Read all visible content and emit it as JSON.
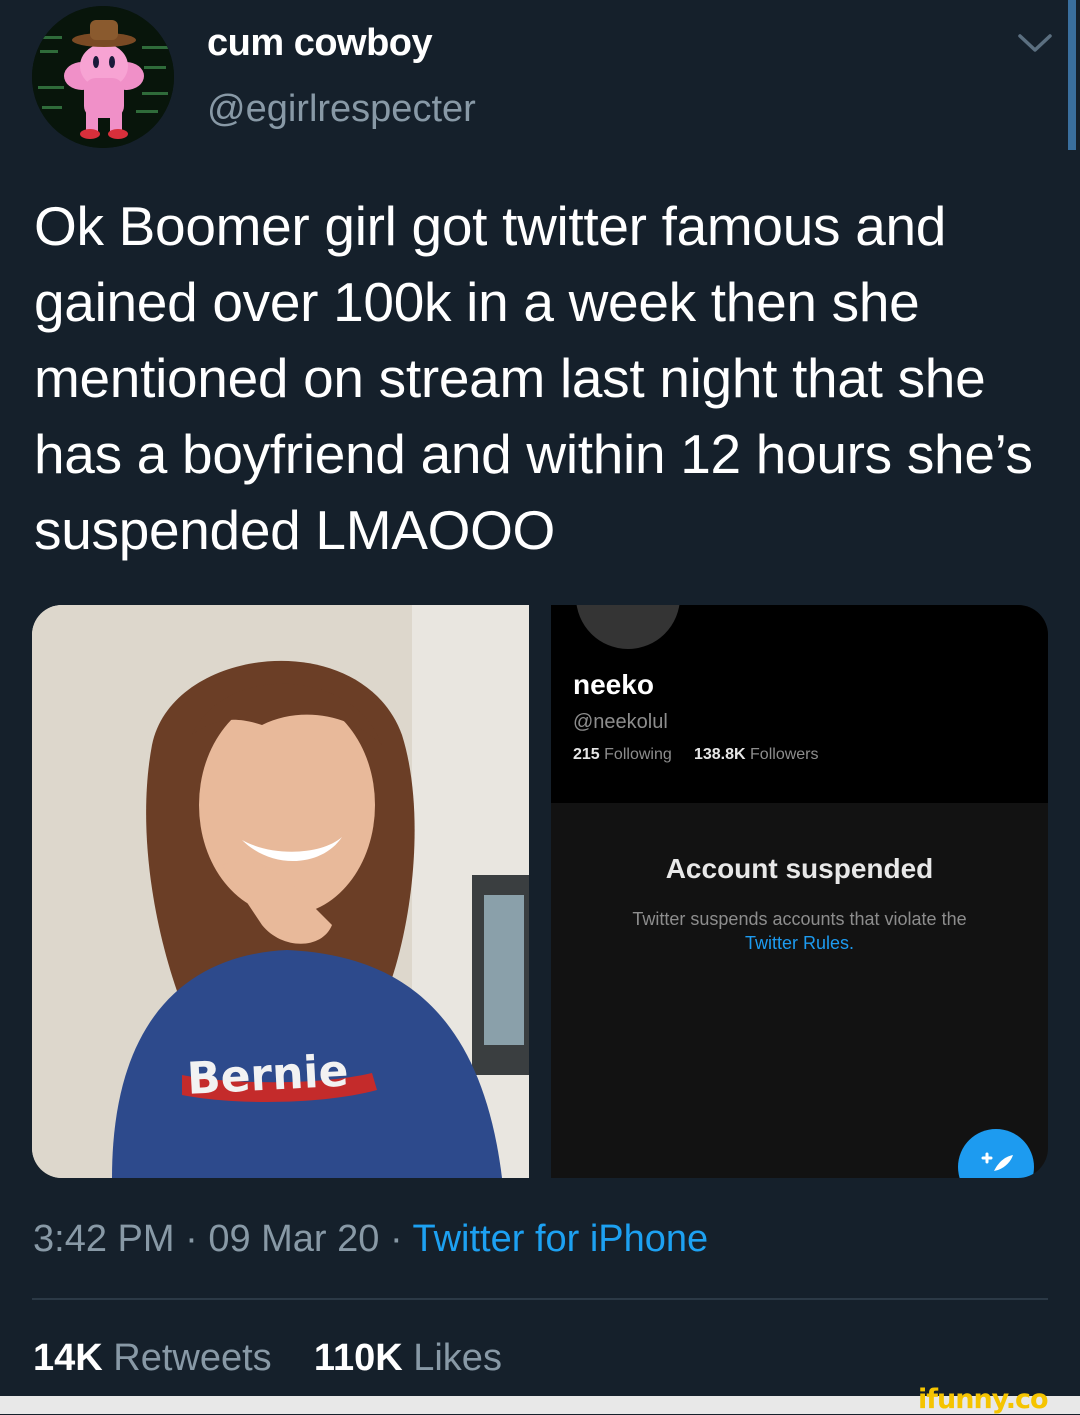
{
  "tweet": {
    "display_name": "cum cowboy",
    "handle": "@egirlrespecter",
    "text": "Ok Boomer girl got twitter famous and gained over 100k in a week then she mentioned on stream last night that she has a boyfriend and within 12 hours she’s suspended LMAOOO",
    "time": "3:42 PM",
    "date": "09 Mar 20",
    "separator": " · ",
    "source": "Twitter for iPhone",
    "retweets_count": "14K",
    "retweets_label": "Retweets",
    "likes_count": "110K",
    "likes_label": "Likes"
  },
  "embedded_profile": {
    "name": "neeko",
    "handle": "@neekolul",
    "following_count": "215",
    "following_label": "Following",
    "followers_count": "138.8K",
    "followers_label": "Followers",
    "suspended_title": "Account suspended",
    "suspended_text": "Twitter suspends accounts that violate the",
    "suspended_link": "Twitter Rules."
  },
  "photo": {
    "shirt_text": "Bernie"
  },
  "watermark": "ifunny.co",
  "icons": {
    "chevron": "chevron-down-icon",
    "compose": "compose-tweet-icon"
  },
  "colors": {
    "background": "#15202b",
    "secondary_text": "#8899a6",
    "link": "#1da1f2"
  }
}
